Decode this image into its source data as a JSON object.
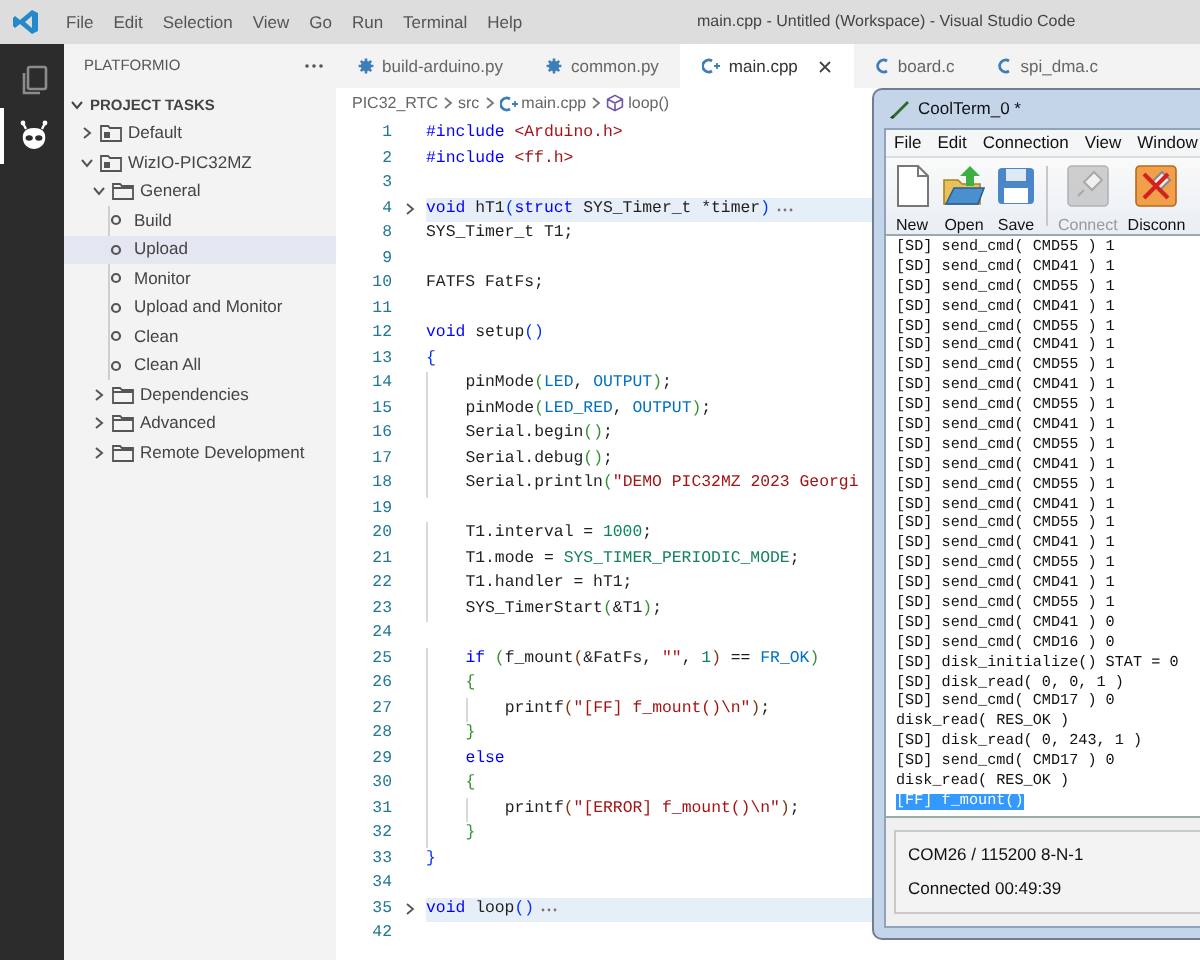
{
  "title_bar": {
    "menu": [
      "File",
      "Edit",
      "Selection",
      "View",
      "Go",
      "Run",
      "Terminal",
      "Help"
    ],
    "title": "main.cpp - Untitled (Workspace) - Visual Studio Code"
  },
  "activity_bar": [
    {
      "kind": "explorer",
      "selected": false
    },
    {
      "kind": "platformio",
      "selected": true
    }
  ],
  "sidebar": {
    "title": "PLATFORMIO",
    "section": {
      "label": "PROJECT TASKS",
      "expanded": true
    },
    "items": [
      {
        "label": "Default",
        "kind": "project",
        "expanded": false,
        "selected": false
      },
      {
        "label": "WizIO-PIC32MZ",
        "kind": "project",
        "expanded": true,
        "selected": false,
        "children": [
          {
            "label": "General",
            "kind": "folder",
            "expanded": true,
            "selected": false,
            "children": [
              {
                "label": "Build",
                "kind": "task",
                "selected": false
              },
              {
                "label": "Upload",
                "kind": "task",
                "selected": true
              },
              {
                "label": "Monitor",
                "kind": "task",
                "selected": false
              },
              {
                "label": "Upload and Monitor",
                "kind": "task",
                "selected": false
              },
              {
                "label": "Clean",
                "kind": "task",
                "selected": false
              },
              {
                "label": "Clean All",
                "kind": "task",
                "selected": false
              }
            ]
          },
          {
            "label": "Dependencies",
            "kind": "folder",
            "expanded": false,
            "selected": false
          },
          {
            "label": "Advanced",
            "kind": "folder",
            "expanded": false,
            "selected": false
          },
          {
            "label": "Remote Development",
            "kind": "folder",
            "expanded": false,
            "selected": false
          }
        ]
      }
    ]
  },
  "editor": {
    "tabs": [
      {
        "label": "build-arduino.py",
        "kind": "python",
        "selected": false
      },
      {
        "label": "common.py",
        "kind": "python",
        "selected": false
      },
      {
        "label": "main.cpp",
        "kind": "cpp",
        "selected": true
      },
      {
        "label": "board.c",
        "kind": "c",
        "selected": false
      },
      {
        "label": "spi_dma.c",
        "kind": "c",
        "selected": false
      }
    ],
    "breadcrumb": [
      {
        "label": "PIC32_RTC",
        "kind": "folder"
      },
      {
        "label": "src",
        "kind": "folder"
      },
      {
        "label": "main.cpp",
        "kind": "cpp"
      },
      {
        "label": "loop()",
        "kind": "function"
      }
    ],
    "lines": [
      {
        "n": "1",
        "folded": false,
        "tokens": [
          {
            "kind": "keyword",
            "text": "#include"
          },
          {
            "kind": "string",
            "text": " <Arduino.h>"
          }
        ]
      },
      {
        "n": "2",
        "folded": false,
        "tokens": [
          {
            "kind": "keyword",
            "text": "#include"
          },
          {
            "kind": "string",
            "text": " <ff.h>"
          }
        ]
      },
      {
        "n": "3",
        "folded": false
      },
      {
        "n": "4",
        "folded": true,
        "tokens": [
          {
            "kind": "keyword",
            "text": "void"
          },
          {
            "kind": "plain",
            "text": " hT1"
          },
          {
            "kind": "bracket1",
            "text": "("
          },
          {
            "kind": "keyword",
            "text": "struct"
          },
          {
            "kind": "plain",
            "text": " SYS_Timer_t *timer"
          },
          {
            "kind": "bracket1",
            "text": ")"
          }
        ]
      },
      {
        "n": "8",
        "folded": false,
        "tokens": [
          {
            "kind": "plain",
            "text": "SYS_Timer_t T1;"
          }
        ]
      },
      {
        "n": "9",
        "folded": false
      },
      {
        "n": "10",
        "folded": false,
        "tokens": [
          {
            "kind": "plain",
            "text": "FATFS FatFs;"
          }
        ]
      },
      {
        "n": "11",
        "folded": false
      },
      {
        "n": "12",
        "folded": false,
        "tokens": [
          {
            "kind": "keyword",
            "text": "void"
          },
          {
            "kind": "plain",
            "text": " setup"
          },
          {
            "kind": "bracket1",
            "text": "()"
          }
        ]
      },
      {
        "n": "13",
        "folded": false,
        "tokens": [
          {
            "kind": "bracket1",
            "text": "{"
          }
        ]
      },
      {
        "n": "14",
        "folded": false,
        "tokens": [
          {
            "kind": "plain",
            "text": "    pinMode"
          },
          {
            "kind": "bracket2",
            "text": "("
          },
          {
            "kind": "constant",
            "text": "LED"
          },
          {
            "kind": "plain",
            "text": ", "
          },
          {
            "kind": "constant",
            "text": "OUTPUT"
          },
          {
            "kind": "bracket2",
            "text": ")"
          },
          {
            "kind": "plain",
            "text": ";"
          }
        ]
      },
      {
        "n": "15",
        "folded": false,
        "tokens": [
          {
            "kind": "plain",
            "text": "    pinMode"
          },
          {
            "kind": "bracket2",
            "text": "("
          },
          {
            "kind": "constant",
            "text": "LED_RED"
          },
          {
            "kind": "plain",
            "text": ", "
          },
          {
            "kind": "constant",
            "text": "OUTPUT"
          },
          {
            "kind": "bracket2",
            "text": ")"
          },
          {
            "kind": "plain",
            "text": ";"
          }
        ]
      },
      {
        "n": "16",
        "folded": false,
        "tokens": [
          {
            "kind": "plain",
            "text": "    Serial.begin"
          },
          {
            "kind": "bracket2",
            "text": "()"
          },
          {
            "kind": "plain",
            "text": ";"
          }
        ]
      },
      {
        "n": "17",
        "folded": false,
        "tokens": [
          {
            "kind": "plain",
            "text": "    Serial.debug"
          },
          {
            "kind": "bracket2",
            "text": "()"
          },
          {
            "kind": "plain",
            "text": ";"
          }
        ]
      },
      {
        "n": "18",
        "folded": false,
        "tokens": [
          {
            "kind": "plain",
            "text": "    Serial.println"
          },
          {
            "kind": "bracket2",
            "text": "("
          },
          {
            "kind": "string",
            "text": "\"DEMO PIC32MZ 2023 Georgi"
          }
        ]
      },
      {
        "n": "19",
        "folded": false
      },
      {
        "n": "20",
        "folded": false,
        "tokens": [
          {
            "kind": "plain",
            "text": "    T1.interval = "
          },
          {
            "kind": "number",
            "text": "1000"
          },
          {
            "kind": "plain",
            "text": ";"
          }
        ]
      },
      {
        "n": "21",
        "folded": false,
        "tokens": [
          {
            "kind": "plain",
            "text": "    T1.mode = "
          },
          {
            "kind": "enum",
            "text": "SYS_TIMER_PERIODIC_MODE"
          },
          {
            "kind": "plain",
            "text": ";"
          }
        ]
      },
      {
        "n": "22",
        "folded": false,
        "tokens": [
          {
            "kind": "plain",
            "text": "    T1.handler = hT1;"
          }
        ]
      },
      {
        "n": "23",
        "folded": false,
        "tokens": [
          {
            "kind": "plain",
            "text": "    SYS_TimerStart"
          },
          {
            "kind": "bracket2",
            "text": "("
          },
          {
            "kind": "plain",
            "text": "&T1"
          },
          {
            "kind": "bracket2",
            "text": ")"
          },
          {
            "kind": "plain",
            "text": ";"
          }
        ]
      },
      {
        "n": "24",
        "folded": false
      },
      {
        "n": "25",
        "folded": false,
        "tokens": [
          {
            "kind": "keyword",
            "text": "    if"
          },
          {
            "kind": "bracket2",
            "text": " ("
          },
          {
            "kind": "plain",
            "text": "f_mount"
          },
          {
            "kind": "bracket3",
            "text": "("
          },
          {
            "kind": "plain",
            "text": "&FatFs, "
          },
          {
            "kind": "string",
            "text": "\"\""
          },
          {
            "kind": "plain",
            "text": ", "
          },
          {
            "kind": "number",
            "text": "1"
          },
          {
            "kind": "bracket3",
            "text": ")"
          },
          {
            "kind": "plain",
            "text": " == "
          },
          {
            "kind": "constant",
            "text": "FR_OK"
          },
          {
            "kind": "bracket2",
            "text": ")"
          }
        ]
      },
      {
        "n": "26",
        "folded": false,
        "tokens": [
          {
            "kind": "bracket2",
            "text": "    {"
          }
        ]
      },
      {
        "n": "27",
        "folded": false,
        "tokens": [
          {
            "kind": "plain",
            "text": "        printf"
          },
          {
            "kind": "bracket3",
            "text": "("
          },
          {
            "kind": "string",
            "text": "\"[FF] f_mount()\\n\""
          },
          {
            "kind": "bracket3",
            "text": ")"
          },
          {
            "kind": "plain",
            "text": ";"
          }
        ]
      },
      {
        "n": "28",
        "folded": false,
        "tokens": [
          {
            "kind": "bracket2",
            "text": "    }"
          }
        ]
      },
      {
        "n": "29",
        "folded": false,
        "tokens": [
          {
            "kind": "keyword",
            "text": "    else"
          }
        ]
      },
      {
        "n": "30",
        "folded": false,
        "tokens": [
          {
            "kind": "bracket2",
            "text": "    {"
          }
        ]
      },
      {
        "n": "31",
        "folded": false,
        "tokens": [
          {
            "kind": "plain",
            "text": "        printf"
          },
          {
            "kind": "bracket3",
            "text": "("
          },
          {
            "kind": "string",
            "text": "\"[ERROR] f_mount()\\n\""
          },
          {
            "kind": "bracket3",
            "text": ")"
          },
          {
            "kind": "plain",
            "text": ";"
          }
        ]
      },
      {
        "n": "32",
        "folded": false,
        "tokens": [
          {
            "kind": "bracket2",
            "text": "    }"
          }
        ]
      },
      {
        "n": "33",
        "folded": false,
        "tokens": [
          {
            "kind": "bracket1",
            "text": "}"
          }
        ]
      },
      {
        "n": "34",
        "folded": false
      },
      {
        "n": "35",
        "folded": true,
        "tokens": [
          {
            "kind": "keyword",
            "text": "void"
          },
          {
            "kind": "plain",
            "text": " loop"
          },
          {
            "kind": "bracket1",
            "text": "()"
          }
        ]
      },
      {
        "n": "42",
        "folded": false
      }
    ]
  },
  "coolterm": {
    "title": "CoolTerm_0 *",
    "menu": [
      "File",
      "Edit",
      "Connection",
      "View",
      "Window"
    ],
    "toolbar": [
      {
        "label": "New",
        "disabled": false
      },
      {
        "label": "Open",
        "disabled": false
      },
      {
        "label": "Save",
        "disabled": false
      },
      {
        "label": "Connect",
        "disabled": true
      },
      {
        "label": "Disconn",
        "disabled": false
      }
    ],
    "lines": [
      {
        "text": "[SD] send_cmd( CMD55 ) 1",
        "selected": false
      },
      {
        "text": "[SD] send_cmd( CMD41 ) 1",
        "selected": false
      },
      {
        "text": "[SD] send_cmd( CMD55 ) 1",
        "selected": false
      },
      {
        "text": "[SD] send_cmd( CMD41 ) 1",
        "selected": false
      },
      {
        "text": "[SD] send_cmd( CMD55 ) 1",
        "selected": false
      },
      {
        "text": "[SD] send_cmd( CMD41 ) 1",
        "selected": false
      },
      {
        "text": "[SD] send_cmd( CMD55 ) 1",
        "selected": false
      },
      {
        "text": "[SD] send_cmd( CMD41 ) 1",
        "selected": false
      },
      {
        "text": "[SD] send_cmd( CMD55 ) 1",
        "selected": false
      },
      {
        "text": "[SD] send_cmd( CMD41 ) 1",
        "selected": false
      },
      {
        "text": "[SD] send_cmd( CMD55 ) 1",
        "selected": false
      },
      {
        "text": "[SD] send_cmd( CMD41 ) 1",
        "selected": false
      },
      {
        "text": "[SD] send_cmd( CMD55 ) 1",
        "selected": false
      },
      {
        "text": "[SD] send_cmd( CMD41 ) 1",
        "selected": false
      },
      {
        "text": "[SD] send_cmd( CMD55 ) 1",
        "selected": false
      },
      {
        "text": "[SD] send_cmd( CMD41 ) 1",
        "selected": false
      },
      {
        "text": "[SD] send_cmd( CMD55 ) 1",
        "selected": false
      },
      {
        "text": "[SD] send_cmd( CMD41 ) 1",
        "selected": false
      },
      {
        "text": "[SD] send_cmd( CMD55 ) 1",
        "selected": false
      },
      {
        "text": "[SD] send_cmd( CMD41 ) 0",
        "selected": false
      },
      {
        "text": "[SD] send_cmd( CMD16 ) 0",
        "selected": false
      },
      {
        "text": "[SD] disk_initialize() STAT = 0",
        "selected": false
      },
      {
        "text": "[SD] disk_read( 0, 0, 1 )",
        "selected": false
      },
      {
        "text": "[SD] send_cmd( CMD17 ) 0",
        "selected": false
      },
      {
        "text": "disk_read( RES_OK )",
        "selected": false
      },
      {
        "text": "[SD] disk_read( 0, 243, 1 )",
        "selected": false
      },
      {
        "text": "[SD] send_cmd( CMD17 ) 0",
        "selected": false
      },
      {
        "text": "disk_read( RES_OK )",
        "selected": false
      },
      {
        "text": "[FF] f_mount()",
        "selected": true
      }
    ],
    "status": [
      "COM26 / 115200 8-N-1",
      "Connected 00:49:39"
    ]
  }
}
